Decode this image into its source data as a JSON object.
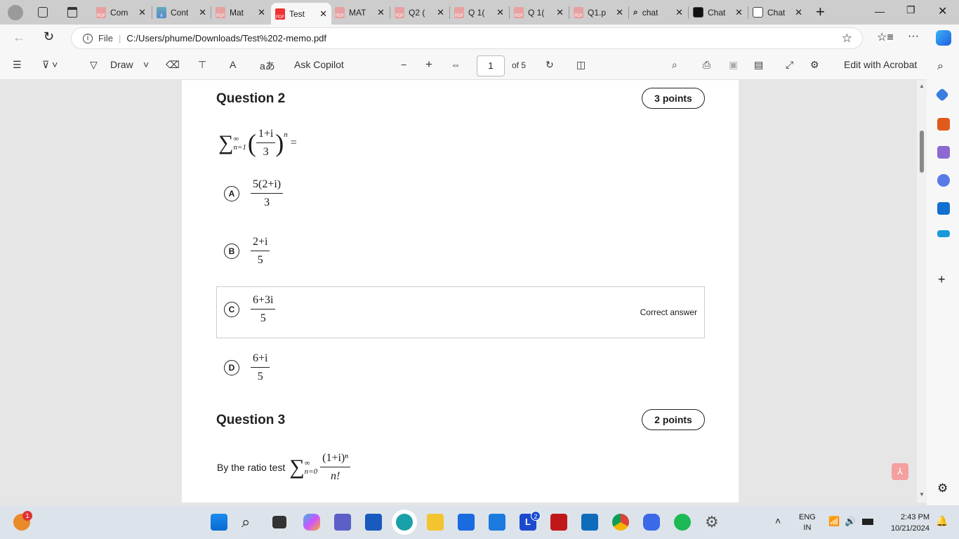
{
  "browser": {
    "tabs": [
      {
        "label": "Com",
        "icon": "pdf-icon"
      },
      {
        "label": "Cont",
        "icon": "app-icon"
      },
      {
        "label": "Mat",
        "icon": "pdf-icon"
      },
      {
        "label": "Test",
        "icon": "pdf-icon",
        "active": true
      },
      {
        "label": "MAT",
        "icon": "pdf-icon"
      },
      {
        "label": "Q2 (",
        "icon": "pdf-icon"
      },
      {
        "label": "Q 1(",
        "icon": "pdf-icon"
      },
      {
        "label": "Q 1(",
        "icon": "pdf-icon"
      },
      {
        "label": "Q1.p",
        "icon": "pdf-icon"
      },
      {
        "label": "chat",
        "icon": "search-icon"
      },
      {
        "label": "Chat",
        "icon": "chatgpt-icon"
      },
      {
        "label": "Chat",
        "icon": "chatgpt-icon"
      }
    ],
    "close_glyph": "✕",
    "new_tab": "+",
    "url_scheme": "File",
    "url": "C:/Users/phume/Downloads/Test%202-memo.pdf"
  },
  "pdf_toolbar": {
    "draw": "Draw",
    "ask_copilot": "Ask Copilot",
    "page": "1",
    "of_pages": "of 5",
    "edit_acrobat": "Edit with Acrobat",
    "minus": "−",
    "plus": "+"
  },
  "document": {
    "q2": {
      "title": "Question 2",
      "points": "3 points",
      "expr_sum": "∑",
      "expr_sup": "∞",
      "expr_sub": "n=1",
      "expr_num": "1+i",
      "expr_den": "3",
      "expr_pow": "n",
      "expr_eq": "=",
      "options": [
        {
          "letter": "A",
          "num": "5(2+i)",
          "den": "3"
        },
        {
          "letter": "B",
          "num": "2+i",
          "den": "5"
        },
        {
          "letter": "C",
          "num": "6+3i",
          "den": "5",
          "correct": true
        },
        {
          "letter": "D",
          "num": "6+i",
          "den": "5"
        }
      ],
      "correct_label": "Correct answer"
    },
    "q3": {
      "title": "Question 3",
      "points": "2 points",
      "text": "By the ratio test",
      "expr_sum": "∑",
      "expr_sup": "∞",
      "expr_sub": "n=0",
      "expr_num": "(1+i)ⁿ",
      "expr_den": "n!"
    }
  },
  "taskbar": {
    "lang1": "ENG",
    "lang2": "IN",
    "time": "2:43 PM",
    "date": "10/21/2024",
    "widget_badge": "1",
    "app_badge": "2"
  }
}
